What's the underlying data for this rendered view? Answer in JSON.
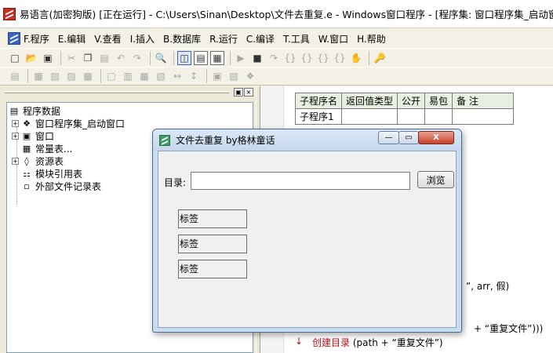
{
  "window": {
    "title": "易语言(加密狗版) [正在运行] - C:\\Users\\Sinan\\Desktop\\文件去重复.e - Windows窗口程序 - [程序集: 窗口程序集_启动窗口 / _"
  },
  "menu": {
    "items": [
      "F.程序",
      "E.编辑",
      "V.查看",
      "I.插入",
      "B.数据库",
      "R.运行",
      "C.编译",
      "T.工具",
      "W.窗口",
      "H.帮助"
    ]
  },
  "toolbar": {
    "row1": [
      "new-file-icon",
      "open-folder-icon",
      "save-icon",
      "cut-icon",
      "copy-icon",
      "paste-icon",
      "undo-icon",
      "redo-icon",
      "find-icon",
      "layout-1-icon",
      "layout-2-icon",
      "layout-3-icon",
      "run-icon",
      "stop-icon",
      "step-icon",
      "step-into-icon",
      "step-over-icon",
      "step-out-icon",
      "run-to-cursor-icon",
      "hand-icon",
      "dog-key-icon"
    ],
    "row2": [
      "align-left-icon",
      "align-center-icon",
      "align-right-icon",
      "align-top-icon",
      "align-middle-icon",
      "align-bottom-icon",
      "same-width-icon",
      "same-height-icon",
      "same-size-icon",
      "hspace-icon",
      "vspace-icon",
      "center-h-icon",
      "center-v-icon",
      "bring-front-icon"
    ]
  },
  "left_panel": {
    "pin_label": "▣",
    "close_label": "×",
    "tree": {
      "root": "程序数据",
      "items": [
        "窗口程序集_启动窗口",
        "窗口",
        "常量表...",
        "资源表",
        "模块引用表",
        "外部文件记录表"
      ]
    }
  },
  "code": {
    "table": {
      "headers": [
        "子程序名",
        "返回值类型",
        "公开",
        "易包",
        "备 注"
      ],
      "rows": [
        [
          "子程序1",
          "",
          "",
          "",
          ""
        ]
      ]
    },
    "line1": "”, arr, 假)",
    "line2_prefix": "+ ",
    "line2_string": "“重复文件”",
    "line2_suffix": ")))",
    "line3_func": "创建目录",
    "line3_args": " (path + ",
    "line3_string": "“重复文件”",
    "line3_end": ")"
  },
  "dialog": {
    "title": "文件去重复 by格林童话",
    "dir_label": "目录:",
    "dir_value": "",
    "browse_label": "浏览",
    "tags": [
      "标签",
      "标签",
      "标签"
    ],
    "min_label": "—",
    "max_label": "▭",
    "close_label": "X"
  },
  "colors": {
    "keyword": "#b5121b",
    "dialog_frame": "#c9dcf0",
    "close_button": "#c7402a"
  }
}
